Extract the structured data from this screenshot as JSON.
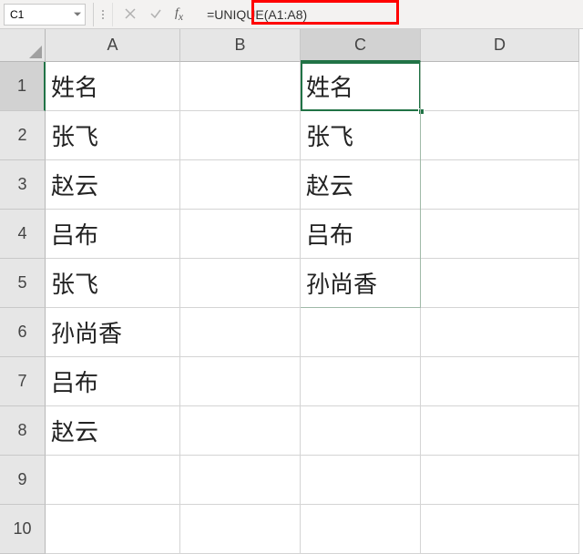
{
  "nameBox": "C1",
  "formula": "=UNIQUE(A1:A8)",
  "columns": [
    "A",
    "B",
    "C",
    "D"
  ],
  "rows": [
    "1",
    "2",
    "3",
    "4",
    "5",
    "6",
    "7",
    "8",
    "9",
    "10"
  ],
  "cells": {
    "A1": "姓名",
    "A2": "张飞",
    "A3": "赵云",
    "A4": "吕布",
    "A5": "张飞",
    "A6": "孙尚香",
    "A7": "吕布",
    "A8": "赵云",
    "C1": "姓名",
    "C2": "张飞",
    "C3": "赵云",
    "C4": "吕布",
    "C5": "孙尚香"
  },
  "selection": {
    "cell": "C1",
    "col": "C",
    "row": "1"
  },
  "colors": {
    "accent": "#217346",
    "highlight": "#ff0000"
  }
}
